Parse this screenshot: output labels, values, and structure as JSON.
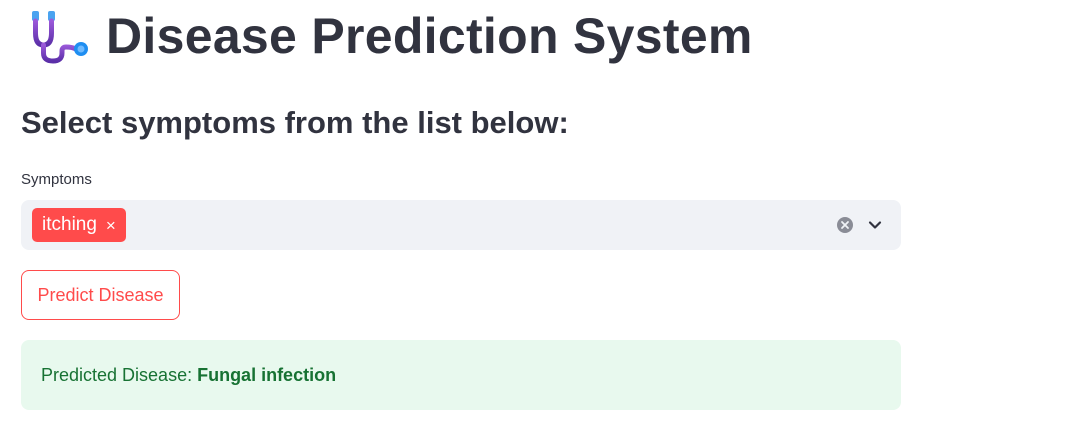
{
  "header": {
    "icon": "stethoscope-icon",
    "title": "Disease Prediction System"
  },
  "subheader": "Select symptoms from the list below:",
  "symptoms_field": {
    "label": "Symptoms",
    "selected": [
      {
        "label": "itching",
        "remove_glyph": "×"
      }
    ],
    "clear_icon": "clear-circle-icon",
    "dropdown_icon": "chevron-down-icon"
  },
  "predict_button": {
    "label": "Predict Disease"
  },
  "result": {
    "prefix": "Predicted Disease:",
    "value": "Fungal infection"
  },
  "colors": {
    "accent": "#ff4b4b",
    "text": "#31333f",
    "input_bg": "#f0f2f6",
    "success_bg": "#e8f9ee",
    "success_text": "#177233"
  }
}
